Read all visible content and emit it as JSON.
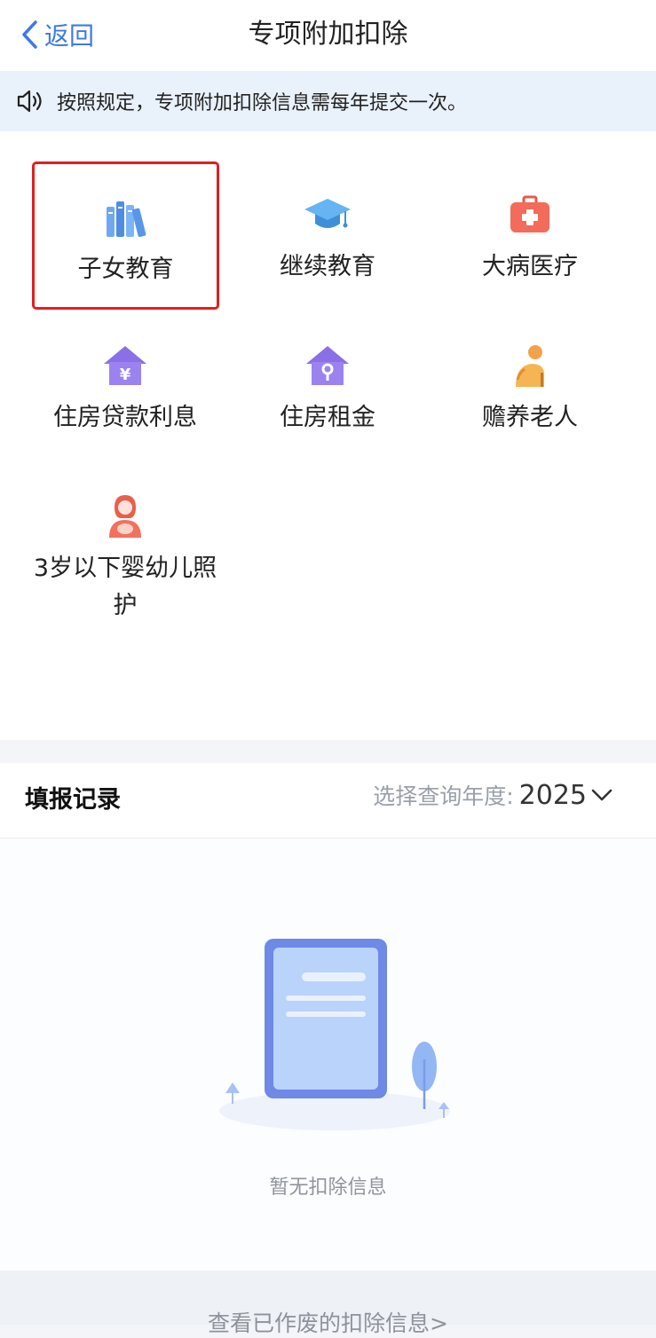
{
  "header": {
    "back_label": "返回",
    "title": "专项附加扣除"
  },
  "notice": {
    "text": "按照规定，专项附加扣除信息需每年提交一次。"
  },
  "categories": [
    {
      "label": "子女教育",
      "icon": "books-icon",
      "selected": true
    },
    {
      "label": "继续教育",
      "icon": "graduation-cap-icon"
    },
    {
      "label": "大病医疗",
      "icon": "medical-kit-icon"
    },
    {
      "label": "住房贷款利息",
      "icon": "house-yuan-icon"
    },
    {
      "label": "住房租金",
      "icon": "house-key-icon"
    },
    {
      "label": "赡养老人",
      "icon": "elderly-person-icon"
    },
    {
      "label": "3岁以下婴幼儿照护",
      "icon": "mother-baby-icon"
    }
  ],
  "records": {
    "title": "填报记录",
    "year_label": "选择查询年度:",
    "year_value": "2025",
    "empty_text": "暂无扣除信息"
  },
  "footer": {
    "link_label": "查看已作废的扣除信息>"
  },
  "colors": {
    "accent": "#3e7be0",
    "selection_border": "#e41e1e",
    "notice_bg": "#e9f1fa"
  }
}
